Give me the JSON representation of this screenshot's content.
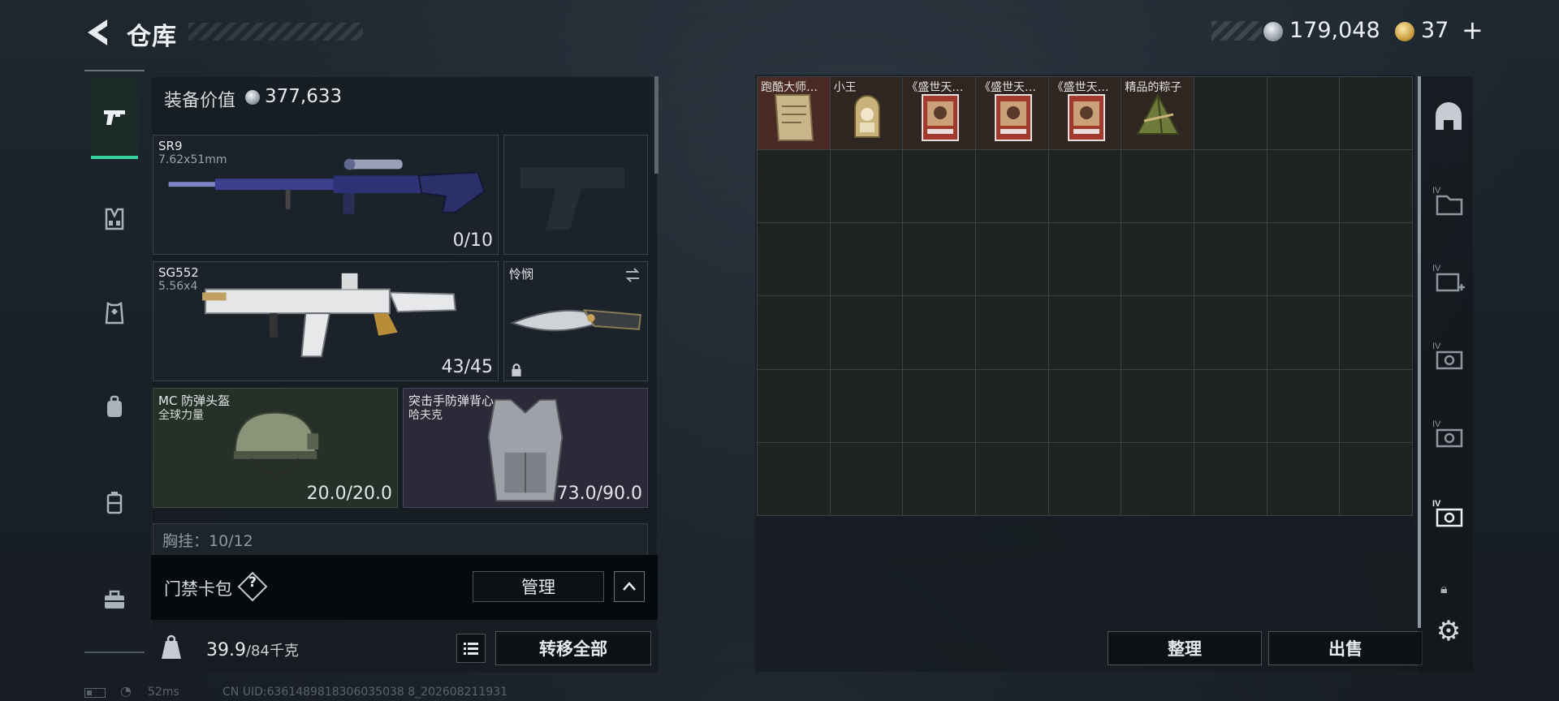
{
  "header": {
    "title": "仓库",
    "currency_silver": "179,048",
    "currency_gold": "37",
    "gold_plus": "+"
  },
  "left_rail": {
    "items": [
      {
        "name": "weapons",
        "selected": true
      },
      {
        "name": "vest"
      },
      {
        "name": "armor"
      },
      {
        "name": "backpack"
      },
      {
        "name": "container"
      },
      {
        "name": "case"
      }
    ]
  },
  "loadout": {
    "equip_value_label": "装备价值",
    "equip_value": "377,633",
    "primary": {
      "name": "SR9",
      "caliber": "7.62x51mm",
      "ammo": "0/10"
    },
    "secondary": {
      "name": "SG552",
      "caliber": "5.56x4",
      "ammo": "43/45"
    },
    "melee": {
      "name": "怜悯"
    },
    "helmet": {
      "name": "MC 防弹头盔",
      "brand": "全球力量",
      "durability": "20.0/20.0"
    },
    "armor": {
      "name": "突击手防弹背心",
      "brand": "哈夫克",
      "durability": "73.0/90.0"
    },
    "chest_rig_label": "胸挂：10/12",
    "card_pack_label": "门禁卡包",
    "help": "?",
    "manage_label": "管理",
    "weight_current": "39.9",
    "weight_rest": "/84千克",
    "transfer_all_label": "转移全部"
  },
  "status": {
    "ping": "52ms",
    "uid": "CN UID:6361489818306035038 8_202608211931"
  },
  "warehouse": {
    "items": [
      {
        "label": "跑酷大师…",
        "icon": "document-icon",
        "highlight": "red"
      },
      {
        "label": "小王",
        "icon": "card-icon"
      },
      {
        "label": "《盛世天…",
        "icon": "book-icon"
      },
      {
        "label": "《盛世天…",
        "icon": "book-icon"
      },
      {
        "label": "《盛世天…",
        "icon": "book-icon"
      },
      {
        "label": "精品的粽子",
        "icon": "zongzi-icon"
      }
    ],
    "columns": 9,
    "rows": 6,
    "sort_label": "整理",
    "sell_label": "出售"
  },
  "colors": {
    "accent": "#38d29b",
    "item_bg": "#2f2621",
    "item_red": "#4a2a25"
  }
}
